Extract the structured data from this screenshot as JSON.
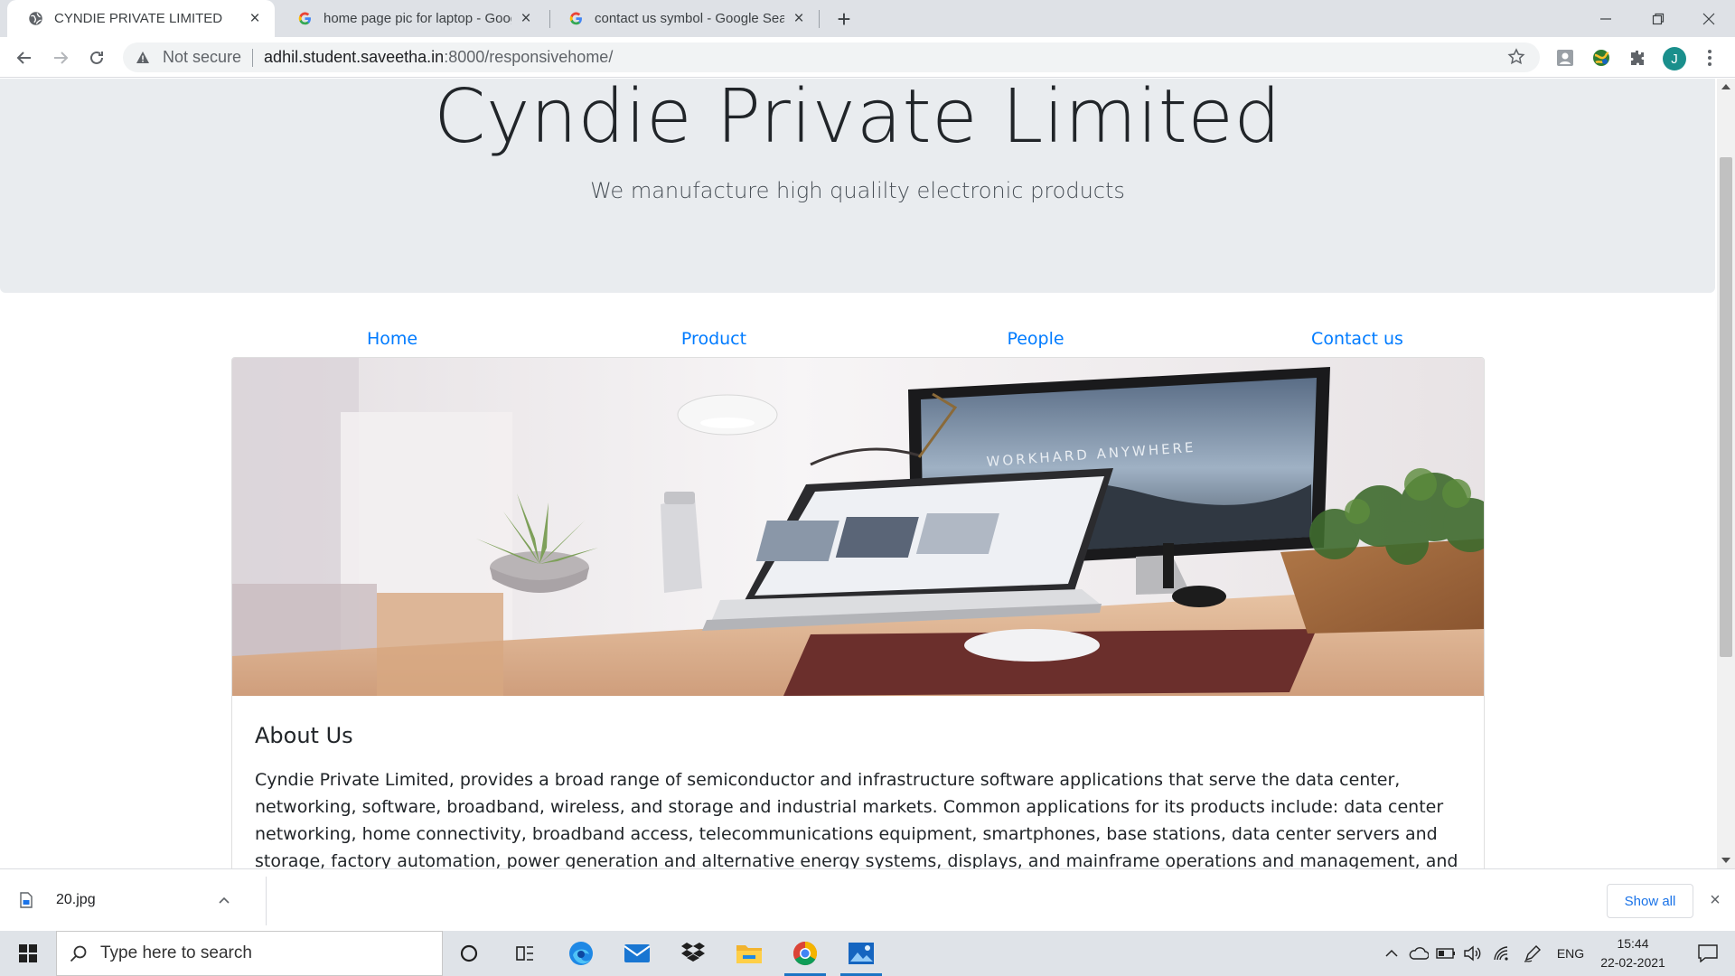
{
  "browser": {
    "tabs": [
      {
        "title": "CYNDIE PRIVATE LIMITED",
        "active": true
      },
      {
        "title": "home page pic for laptop - Goog",
        "active": false
      },
      {
        "title": "contact us symbol - Google Sear",
        "active": false
      }
    ],
    "security_label": "Not secure",
    "url_host": "adhil.student.saveetha.in",
    "url_path": ":8000/responsivehome/",
    "profile_initial": "J"
  },
  "page": {
    "title": "Cyndie Private Limited",
    "tagline": "We manufacture high qualilty electronic products",
    "nav": [
      "Home",
      "Product",
      "People",
      "Contact us"
    ],
    "hero_text": "WORKHARD ANYWHERE",
    "about_heading": "About Us",
    "about_text": "Cyndie Private Limited, provides a broad range of semiconductor and infrastructure software applications that serve the data center, networking, software, broadband, wireless, and storage and industrial markets. Common applications for its products include: data center networking, home connectivity, broadband access, telecommunications equipment, smartphones, base stations, data center servers and storage, factory automation, power generation and alternative energy systems, displays, and mainframe operations and management, and application software development. Some"
  },
  "downloads": {
    "file": "20.jpg",
    "show_all": "Show all"
  },
  "taskbar": {
    "search_placeholder": "Type here to search",
    "language": "ENG",
    "time": "15:44",
    "date": "22-02-2021"
  },
  "colors": {
    "link": "#007bff",
    "jumbotron_bg": "#e9ecef",
    "taskbar_bg": "#dfe3e8"
  }
}
